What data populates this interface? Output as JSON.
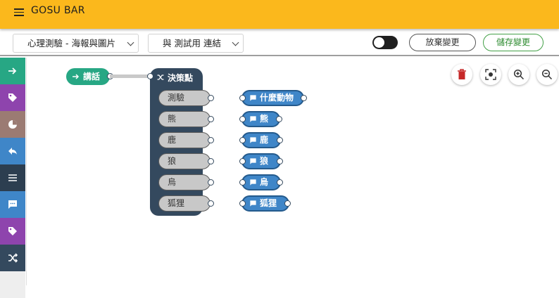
{
  "app": {
    "title": "GOSU BAR"
  },
  "toolbar": {
    "script_select": "心理測驗 - 海報與圖片",
    "link_select": "與 測試用 連結",
    "discard_label": "放棄變更",
    "save_label": "儲存變更",
    "toggle_on": false
  },
  "toolbox": [
    {
      "icon": "arrow-right-icon",
      "color": "#27a784"
    },
    {
      "icon": "tag-icon",
      "color": "#8e44ad"
    },
    {
      "icon": "pie-chart-icon",
      "color": "#9b7b73"
    },
    {
      "icon": "reply-icon",
      "color": "#3f86c8"
    },
    {
      "icon": "menu-lines-icon",
      "color": "#2c3e50"
    },
    {
      "icon": "chat-icon",
      "color": "#3f86c8"
    },
    {
      "icon": "tag-icon",
      "color": "#8e44ad"
    },
    {
      "icon": "shuffle-icon",
      "color": "#34495e"
    }
  ],
  "workspace": {
    "say_block": "講話",
    "decision_block": "決策點",
    "choices": [
      "測驗",
      "熊",
      "鹿",
      "狼",
      "烏",
      "狐狸"
    ],
    "targets": [
      "什麼動物",
      "熊",
      "鹿",
      "狼",
      "烏",
      "狐狸"
    ]
  }
}
